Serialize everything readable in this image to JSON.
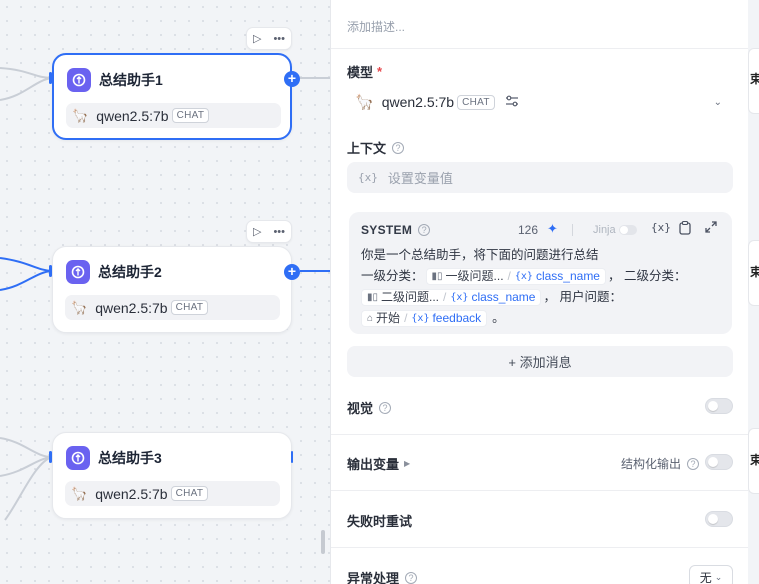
{
  "nodes": [
    {
      "title": "总结助手1",
      "model": "qwen2.5:7b",
      "badge": "CHAT",
      "selected": true
    },
    {
      "title": "总结助手2",
      "model": "qwen2.5:7b",
      "badge": "CHAT",
      "selected": false
    },
    {
      "title": "总结助手3",
      "model": "qwen2.5:7b",
      "badge": "CHAT",
      "selected": false
    }
  ],
  "toolbar_icons": [
    "play-icon",
    "more-icon"
  ],
  "panel": {
    "description_placeholder": "添加描述...",
    "model": {
      "label": "模型",
      "required": "*",
      "name": "qwen2.5:7b",
      "badge": "CHAT"
    },
    "context": {
      "label": "上下文",
      "placeholder": "设置变量值",
      "var_glyph": "{x}"
    },
    "system": {
      "title": "SYSTEM",
      "count": "126",
      "jinja_label": "Jinja",
      "prompt_line1": "你是一个总结助手，将下面的问题进行总结",
      "l2_prefix": "一级分类：",
      "l2_node": "一级问题...",
      "l2_var": "class_name",
      "l2_mid": "，  二级分类：",
      "l3_node": "二级问题...",
      "l3_var": "class_name",
      "l3_mid": "，  用户问题：",
      "l4_node": "开始",
      "l4_var": "feedback",
      "l4_end": "。",
      "var_glyph": "{x}",
      "slash": "/"
    },
    "add_message": "+ 添加消息",
    "vision": {
      "label": "视觉",
      "enabled": false
    },
    "output_vars": {
      "label": "输出变量",
      "structured_label": "结构化输出",
      "structured_enabled": false
    },
    "retry": {
      "label": "失败时重试",
      "enabled": false
    },
    "error_handling": {
      "label": "异常处理",
      "value": "无"
    }
  },
  "right_strip_text": [
    "束",
    "束",
    "束"
  ],
  "colors": {
    "accent": "#2f6ef5",
    "llm_icon": "#6a62f0",
    "required": "#e5484d"
  }
}
